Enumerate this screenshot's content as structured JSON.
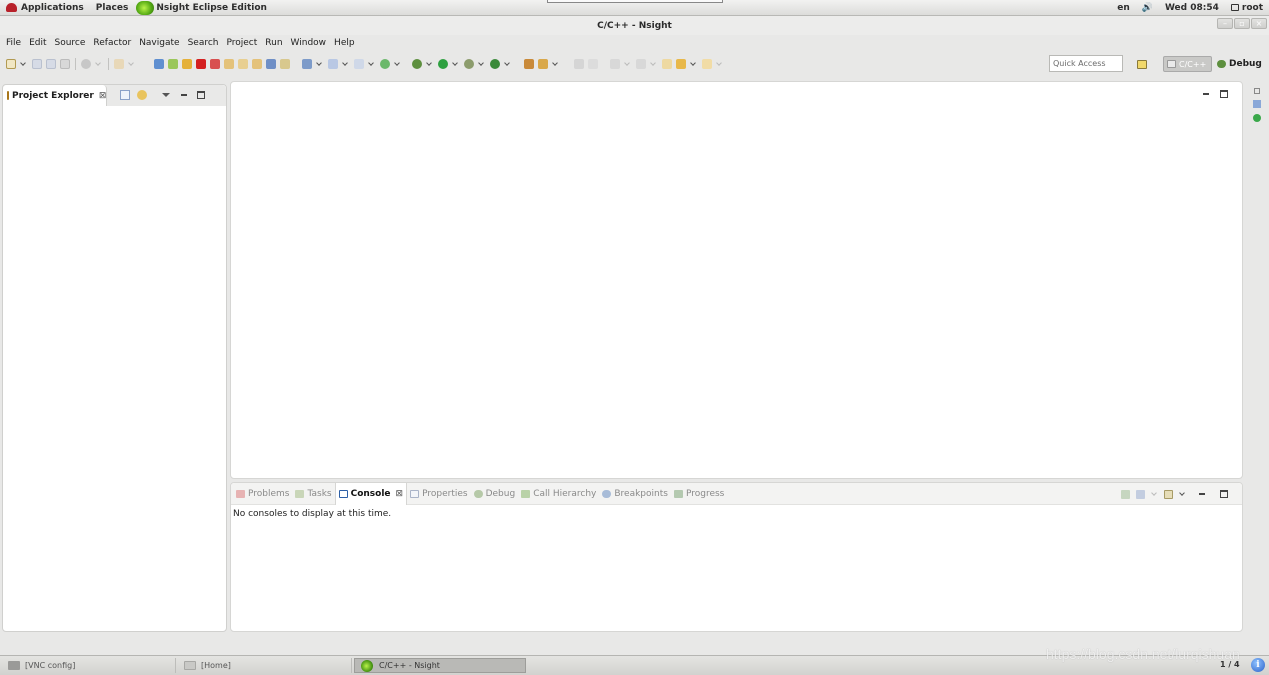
{
  "top_panel": {
    "applications": "Applications",
    "places": "Places",
    "active_app": "Nsight Eclipse Edition",
    "lang": "en",
    "datetime": "Wed 08:54",
    "user": "root"
  },
  "window": {
    "title": "C/C++ - Nsight"
  },
  "menu": [
    "File",
    "Edit",
    "Source",
    "Refactor",
    "Navigate",
    "Search",
    "Project",
    "Run",
    "Window",
    "Help"
  ],
  "toolbar": {
    "quick_access_placeholder": "Quick Access",
    "perspectives": [
      {
        "label": "C/C++",
        "active": true
      },
      {
        "label": "Debug",
        "active": false
      }
    ]
  },
  "project_explorer": {
    "tab_label": "Project Explorer",
    "close": "⊠"
  },
  "console_view": {
    "tabs": [
      {
        "label": "Problems",
        "icon": "problems-icon",
        "active": false
      },
      {
        "label": "Tasks",
        "icon": "tasks-icon",
        "active": false
      },
      {
        "label": "Console",
        "icon": "console-icon",
        "active": true
      },
      {
        "label": "Properties",
        "icon": "properties-icon",
        "active": false
      },
      {
        "label": "Debug",
        "icon": "debug-icon",
        "active": false
      },
      {
        "label": "Call Hierarchy",
        "icon": "call-hierarchy-icon",
        "active": false
      },
      {
        "label": "Breakpoints",
        "icon": "breakpoints-icon",
        "active": false
      },
      {
        "label": "Progress",
        "icon": "progress-icon",
        "active": false
      }
    ],
    "close": "⊠",
    "message": "No consoles to display at this time."
  },
  "taskbar": {
    "tasks": [
      {
        "label": "[VNC config]",
        "active": false
      },
      {
        "label": "[Home]",
        "active": false
      },
      {
        "label": "C/C++ - Nsight",
        "active": true
      }
    ],
    "pager": "1 / 4",
    "info": "i"
  },
  "watermark": "https://blog.csdn.net/lurqishuan",
  "colors": {
    "accent_green": "#54a914",
    "folder_yellow": "#f4c545",
    "stop_red": "#d42020"
  }
}
